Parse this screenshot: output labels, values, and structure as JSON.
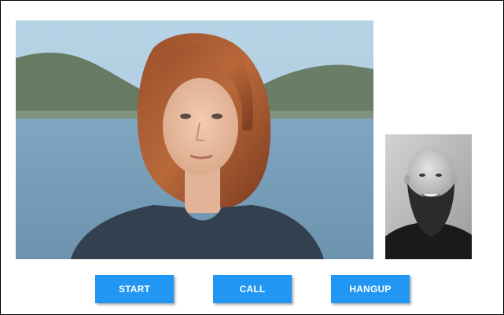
{
  "controls": {
    "start_label": "START",
    "call_label": "CALL",
    "hangup_label": "HANGUP"
  },
  "colors": {
    "button_bg": "#2196f3",
    "button_text": "#ffffff",
    "page_bg": "#ffffff",
    "border": "#000000"
  }
}
